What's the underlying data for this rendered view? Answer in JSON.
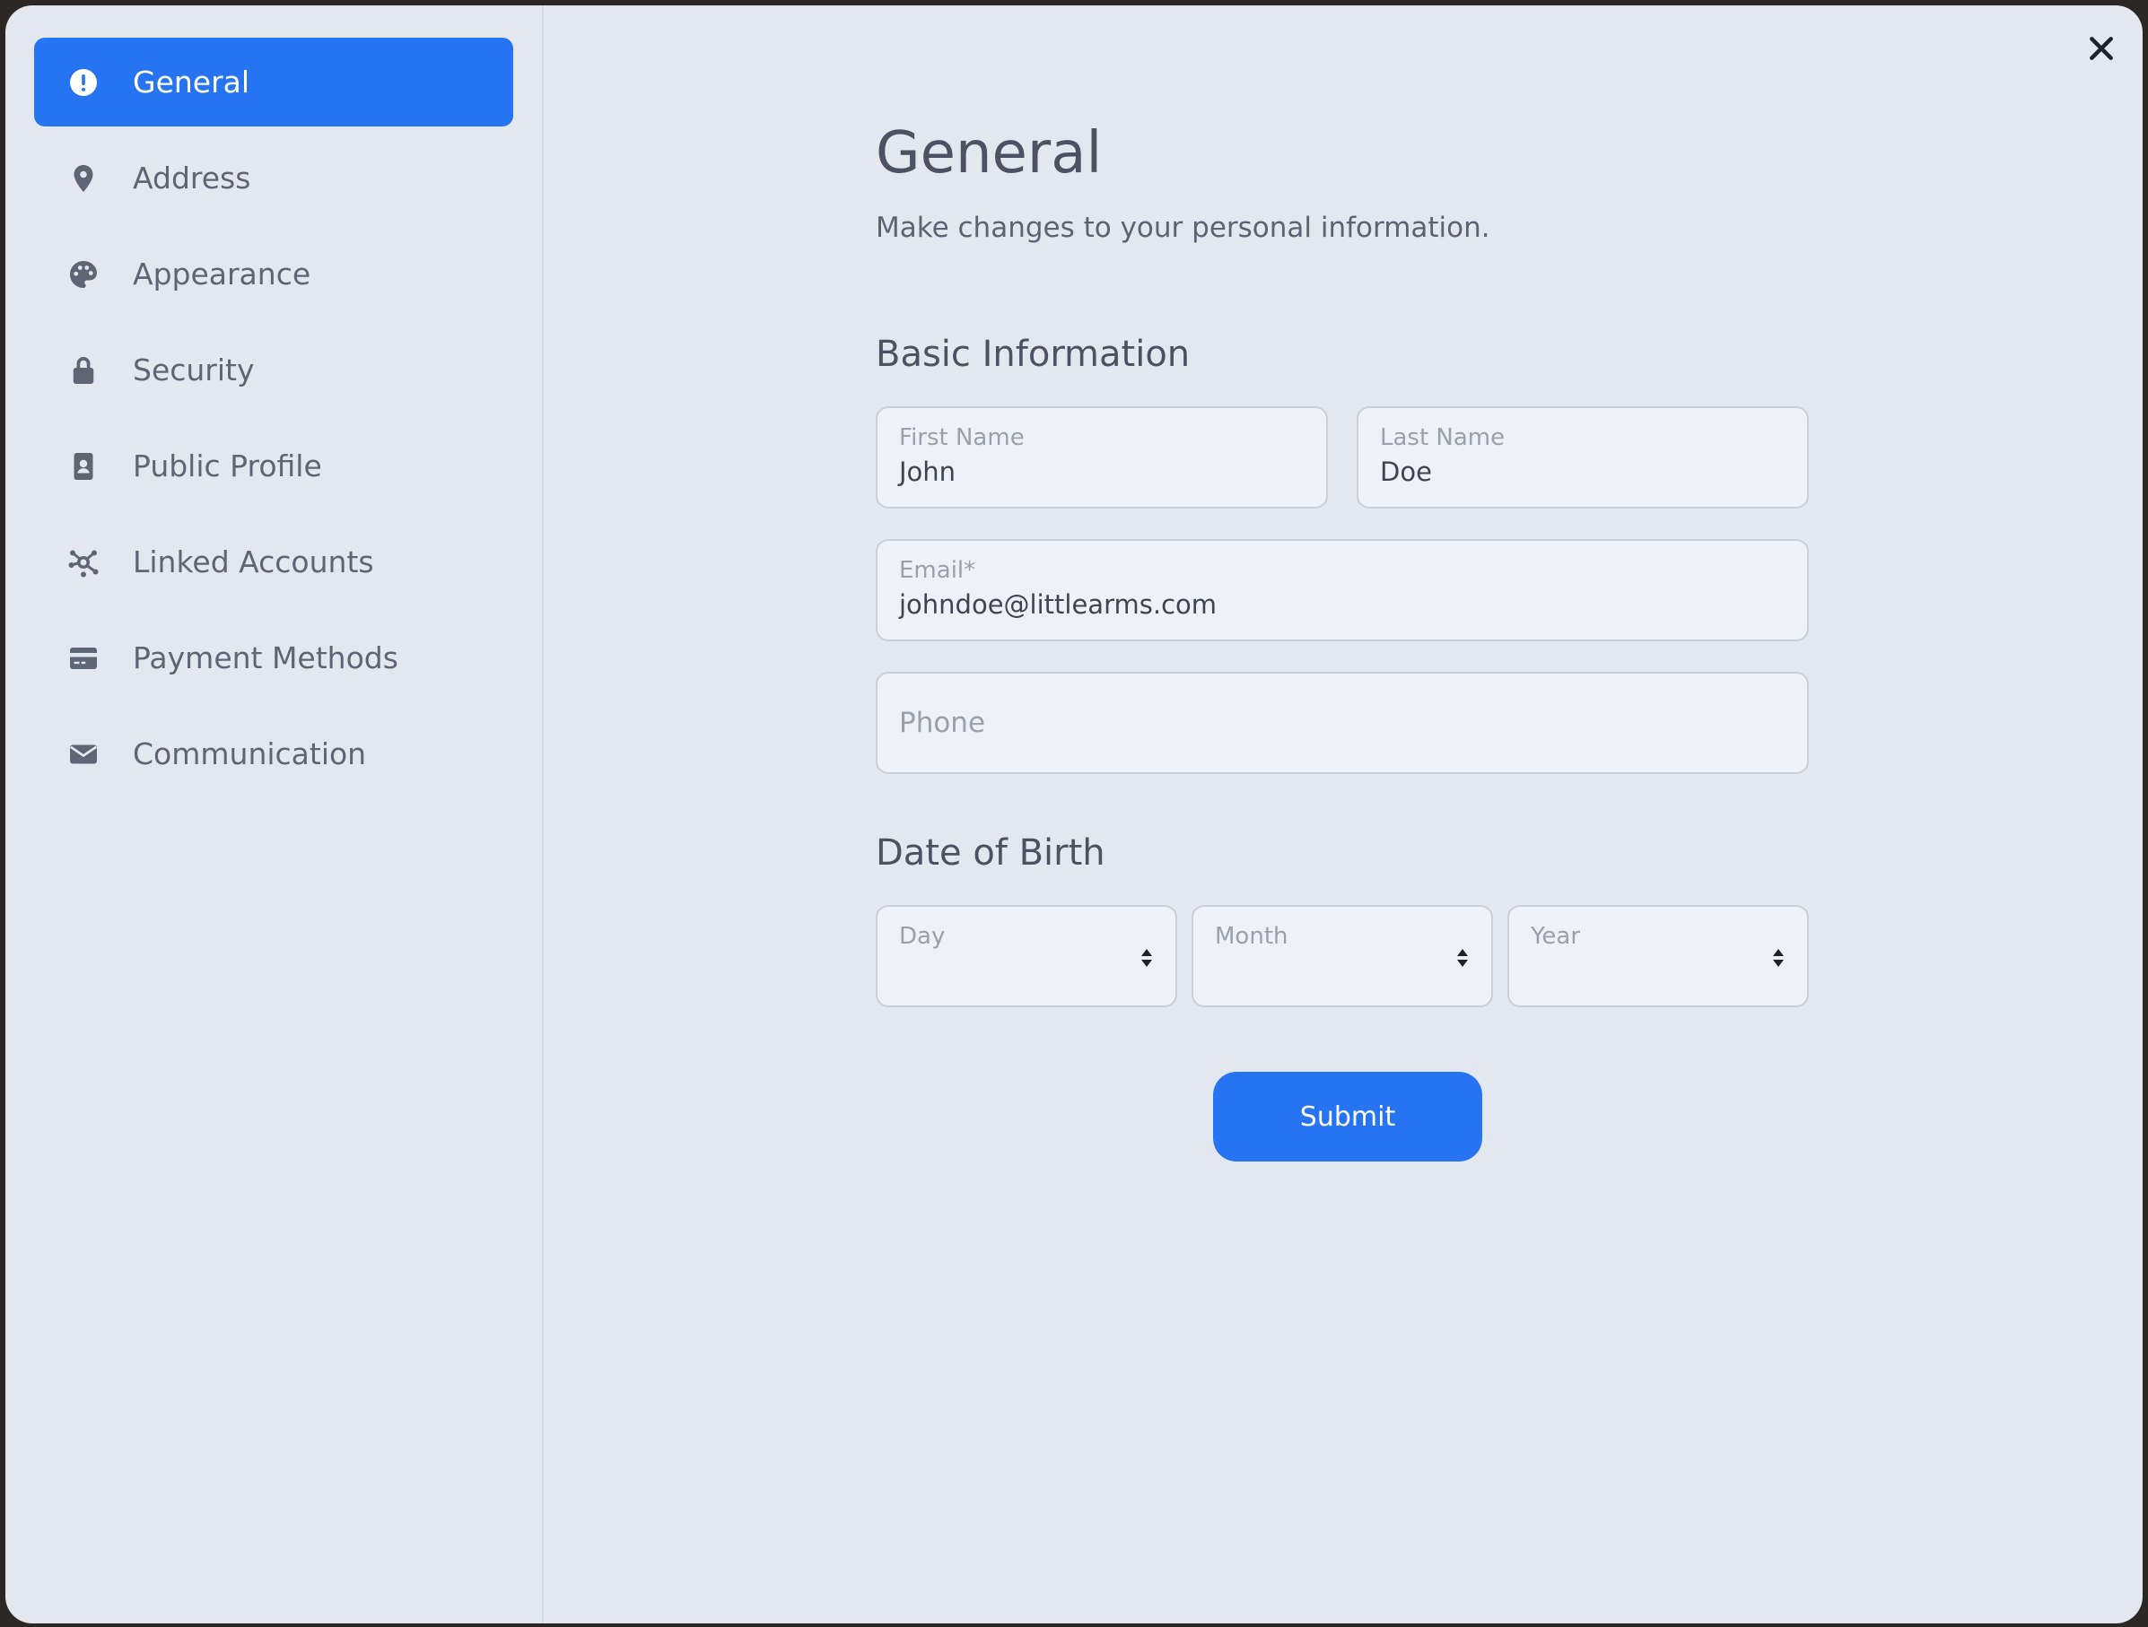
{
  "sidebar": {
    "items": [
      {
        "label": "General",
        "icon": "alert-circle-icon",
        "active": true
      },
      {
        "label": "Address",
        "icon": "map-pin-icon",
        "active": false
      },
      {
        "label": "Appearance",
        "icon": "palette-icon",
        "active": false
      },
      {
        "label": "Security",
        "icon": "lock-icon",
        "active": false
      },
      {
        "label": "Public Profile",
        "icon": "id-badge-icon",
        "active": false
      },
      {
        "label": "Linked Accounts",
        "icon": "network-icon",
        "active": false
      },
      {
        "label": "Payment Methods",
        "icon": "credit-card-icon",
        "active": false
      },
      {
        "label": "Communication",
        "icon": "envelope-icon",
        "active": false
      }
    ]
  },
  "header": {
    "title": "General",
    "subtitle": "Make changes to your personal information."
  },
  "basic_info": {
    "heading": "Basic Information",
    "first_name": {
      "label": "First Name",
      "value": "John"
    },
    "last_name": {
      "label": "Last Name",
      "value": "Doe"
    },
    "email": {
      "label": "Email*",
      "value": "johndoe@littlearms.com"
    },
    "phone": {
      "placeholder": "Phone"
    }
  },
  "dob": {
    "heading": "Date of Birth",
    "day": {
      "label": "Day"
    },
    "month": {
      "label": "Month"
    },
    "year": {
      "label": "Year"
    }
  },
  "actions": {
    "submit_label": "Submit"
  },
  "colors": {
    "accent": "#2674f2",
    "panel_bg": "#e3e8f0",
    "field_bg": "#eef1f8"
  }
}
